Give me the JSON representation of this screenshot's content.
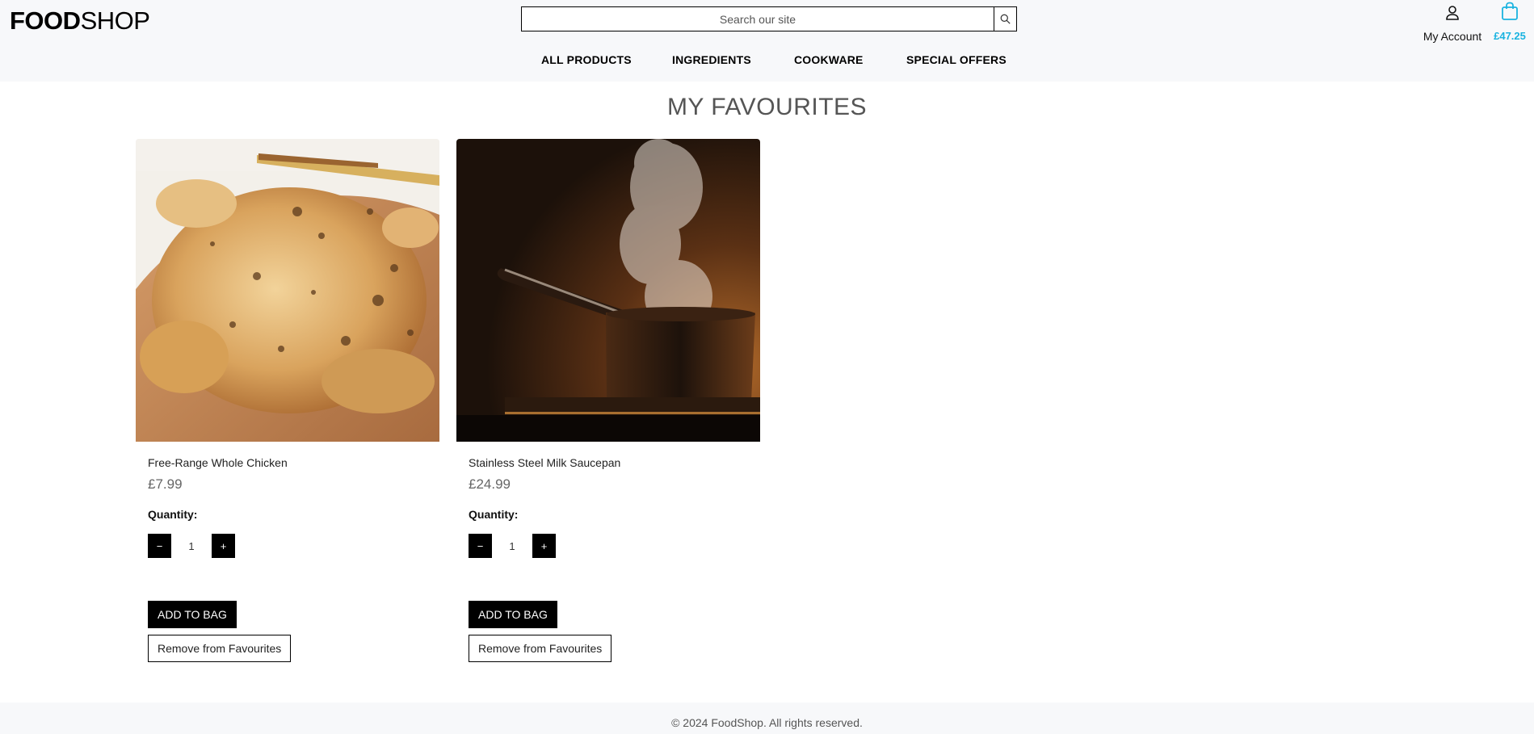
{
  "header": {
    "logo_bold": "FOOD",
    "logo_light": "SHOP",
    "search_placeholder": "Search our site",
    "account_label": "My Account",
    "bag_total": "£47.25",
    "bag_color": "#1ab3e0"
  },
  "nav": {
    "items": [
      "ALL PRODUCTS",
      "INGREDIENTS",
      "COOKWARE",
      "SPECIAL OFFERS"
    ]
  },
  "main": {
    "title": "MY FAVOURITES",
    "products": [
      {
        "name": "Free-Range Whole Chicken",
        "price": "£7.99",
        "quantity_label": "Quantity:",
        "quantity": "1",
        "add_label": "ADD TO BAG",
        "remove_label": "Remove from Favourites",
        "image": "roast-chicken-photo"
      },
      {
        "name": "Stainless Steel Milk Saucepan",
        "price": "£24.99",
        "quantity_label": "Quantity:",
        "quantity": "1",
        "add_label": "ADD TO BAG",
        "remove_label": "Remove from Favourites",
        "image": "steaming-saucepan-photo"
      }
    ],
    "stepper_minus": "−",
    "stepper_plus": "+"
  },
  "footer": {
    "text": "© 2024 FoodShop. All rights reserved."
  }
}
